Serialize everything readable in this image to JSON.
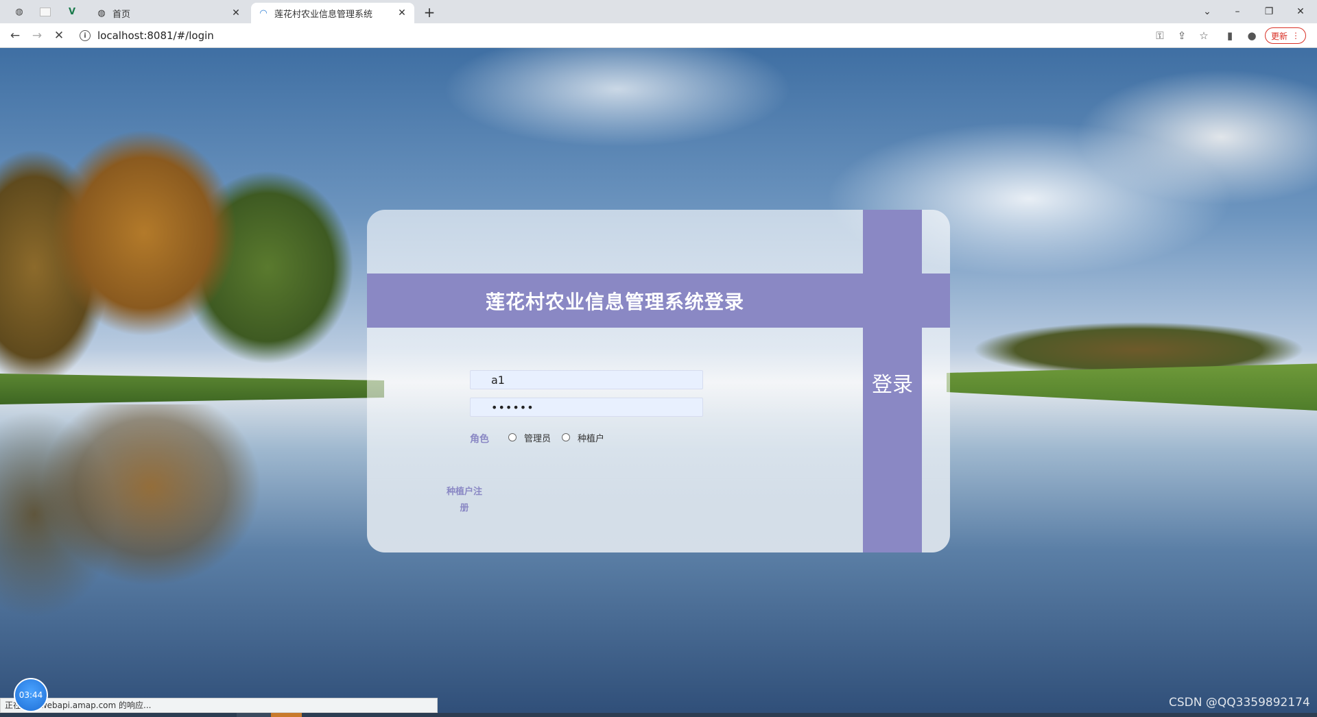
{
  "browser": {
    "tabs": [
      {
        "title": "",
        "icon": "globe-icon"
      },
      {
        "title": "",
        "icon": "blank-page-icon"
      },
      {
        "title": "",
        "icon": "vue-logo-icon"
      },
      {
        "title": "首页",
        "icon": "globe-icon"
      },
      {
        "title": "莲花村农业信息管理系统",
        "icon": "site-logo-icon",
        "active": true
      }
    ],
    "new_tab": "+",
    "url": "localhost:8081/#/login",
    "update_button": "更新",
    "window_controls": {
      "tab_search": "⌄",
      "minimize": "–",
      "restore": "❐",
      "close": "✕"
    }
  },
  "login": {
    "title": "莲花村农业信息管理系统登录",
    "username_value": "a1",
    "password_value": "••••••",
    "role_label": "角色",
    "roles": [
      {
        "label": "管理员",
        "selected": false
      },
      {
        "label": "种植户",
        "selected": false
      }
    ],
    "register_link_line1": "种植户注",
    "register_link_line2": "册",
    "login_button": "登录",
    "accent_color": "#8a88c4"
  },
  "status": {
    "text": "正在等待 webapi.amap.com 的响应...",
    "timer": "03:44"
  },
  "watermark": "CSDN @QQ3359892174"
}
